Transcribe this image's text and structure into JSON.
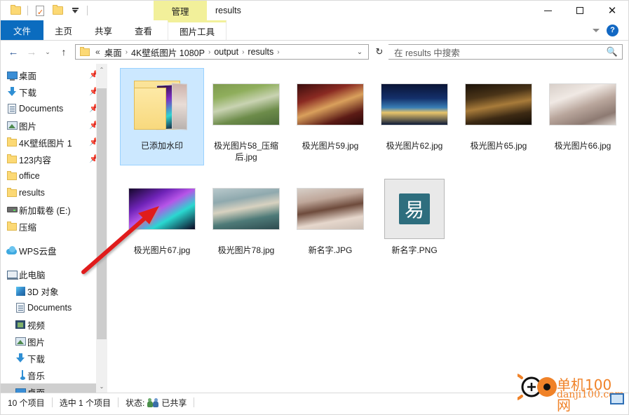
{
  "window": {
    "title": "results",
    "contextual_tab": "管理",
    "controls": {
      "minimize": "minimize-icon",
      "maximize": "maximize-icon",
      "close": "close-icon"
    }
  },
  "quick_access": {
    "items": [
      {
        "name": "new-folder-icon",
        "label": ""
      },
      {
        "name": "properties-icon",
        "label": ""
      },
      {
        "name": "folder-icon",
        "label": ""
      },
      {
        "name": "customize-dropdown-icon",
        "label": ""
      }
    ]
  },
  "ribbon": {
    "tabs": [
      {
        "id": "file",
        "label": "文件"
      },
      {
        "id": "home",
        "label": "主页"
      },
      {
        "id": "share",
        "label": "共享"
      },
      {
        "id": "view",
        "label": "查看"
      },
      {
        "id": "picture-tools",
        "label": "图片工具"
      }
    ],
    "collapse_label": "⌄",
    "help_label": "?"
  },
  "address": {
    "back": "←",
    "forward": "→",
    "recent": "⌄",
    "up": "↑",
    "ellipsis": "«",
    "crumbs": [
      "桌面",
      "4K壁纸图片 1080P",
      "output",
      "results"
    ],
    "separator": "›",
    "dropdown": "⌄",
    "refresh": "↻"
  },
  "search": {
    "placeholder": "在 results 中搜索",
    "icon": "search-icon"
  },
  "sidebar": {
    "quick_access": [
      {
        "label": "桌面",
        "icon": "desktop-icon",
        "pinned": true
      },
      {
        "label": "下载",
        "icon": "download-icon",
        "pinned": true
      },
      {
        "label": "Documents",
        "icon": "documents-icon",
        "pinned": true
      },
      {
        "label": "图片",
        "icon": "pictures-icon",
        "pinned": true
      },
      {
        "label": "4K壁纸图片 1",
        "icon": "folder-icon",
        "pinned": true
      },
      {
        "label": "123内容",
        "icon": "folder-icon",
        "pinned": true
      },
      {
        "label": "office",
        "icon": "folder-icon",
        "pinned": false
      },
      {
        "label": "results",
        "icon": "folder-icon",
        "pinned": false
      },
      {
        "label": "新加载卷 (E:)",
        "icon": "drive-icon",
        "pinned": false
      },
      {
        "label": "压缩",
        "icon": "folder-icon",
        "pinned": false
      }
    ],
    "cloud": [
      {
        "label": "WPS云盘",
        "icon": "cloud-icon"
      }
    ],
    "this_pc": {
      "label": "此电脑",
      "icon": "computer-icon",
      "children": [
        {
          "label": "3D 对象",
          "icon": "3d-objects-icon"
        },
        {
          "label": "Documents",
          "icon": "documents-icon"
        },
        {
          "label": "视频",
          "icon": "videos-icon"
        },
        {
          "label": "图片",
          "icon": "pictures-icon"
        },
        {
          "label": "下载",
          "icon": "download-icon"
        },
        {
          "label": "音乐",
          "icon": "music-icon"
        },
        {
          "label": "桌面",
          "icon": "desktop-icon",
          "selected": true
        }
      ]
    },
    "scrollbar": {
      "up": "⌃",
      "down": "⌄"
    }
  },
  "files": [
    {
      "name": "已添加水印",
      "type": "folder",
      "selected": true,
      "thumb_class": "folder"
    },
    {
      "name": "极光图片58_压缩后.jpg",
      "type": "image",
      "selected": false,
      "thumb_class": "img58"
    },
    {
      "name": "极光图片59.jpg",
      "type": "image",
      "selected": false,
      "thumb_class": "img59"
    },
    {
      "name": "极光图片62.jpg",
      "type": "image",
      "selected": false,
      "thumb_class": "img62"
    },
    {
      "name": "极光图片65.jpg",
      "type": "image",
      "selected": false,
      "thumb_class": "img65"
    },
    {
      "name": "极光图片66.jpg",
      "type": "image",
      "selected": false,
      "thumb_class": "img66"
    },
    {
      "name": "极光图片67.jpg",
      "type": "image",
      "selected": false,
      "thumb_class": "img67"
    },
    {
      "name": "极光图片78.jpg",
      "type": "image",
      "selected": false,
      "thumb_class": "img78"
    },
    {
      "name": "新名字.JPG",
      "type": "image",
      "selected": false,
      "thumb_class": "imgjpg"
    },
    {
      "name": "新名字.PNG",
      "type": "image",
      "selected": false,
      "thumb_class": "imgpng",
      "logo_text": "易"
    }
  ],
  "statusbar": {
    "item_count": "10 个项目",
    "selection": "选中 1 个项目",
    "status_label": "状态:",
    "status_value": "已共享"
  },
  "watermark": {
    "main": "单机100网",
    "sub": "danji100.com"
  },
  "annotation": {
    "arrow_color": "#e01b1b",
    "target": "已添加水印"
  },
  "colors": {
    "accent": "#0b6cbf",
    "contextual_tab_bg": "#f2f09a",
    "selection_bg": "#cce8ff",
    "selection_border": "#99d1ff",
    "folder_yellow": "#fcd975",
    "watermark_orange": "#f08228"
  }
}
